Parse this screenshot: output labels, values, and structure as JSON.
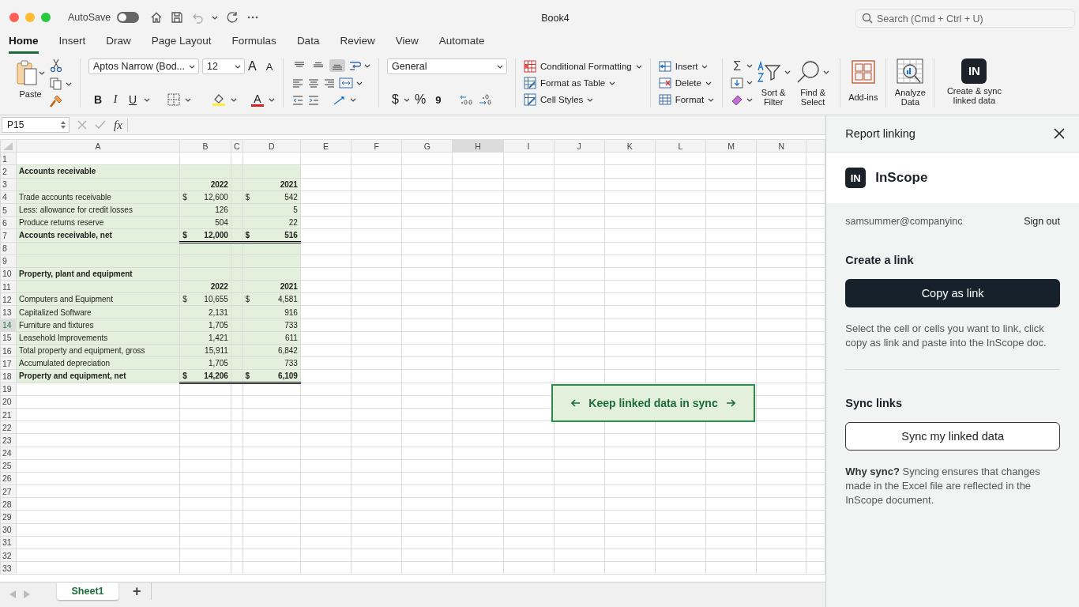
{
  "titlebar": {
    "autosave": {
      "label": "AutoSave",
      "on": false
    },
    "title": "Book4",
    "search": {
      "placeholder": "Search (Cmd + Ctrl + U)"
    }
  },
  "tabs": [
    {
      "label": "Home",
      "selected": true
    },
    {
      "label": "Insert",
      "selected": false
    },
    {
      "label": "Draw",
      "selected": false
    },
    {
      "label": "Page Layout",
      "selected": false
    },
    {
      "label": "Formulas",
      "selected": false
    },
    {
      "label": "Data",
      "selected": false
    },
    {
      "label": "Review",
      "selected": false
    },
    {
      "label": "View",
      "selected": false
    },
    {
      "label": "Automate",
      "selected": false
    }
  ],
  "ribbon": {
    "paste": "Paste",
    "font_name": "Aptos Narrow (Bod...",
    "font_size": "12",
    "grow_font": "A",
    "shrink_font": "A",
    "bold": "B",
    "italic": "I",
    "underline": "U",
    "font_color": "A",
    "vertical_align": [
      {
        "kind": "top",
        "selected": false
      },
      {
        "kind": "middle",
        "selected": false
      },
      {
        "kind": "bottom",
        "selected": true
      }
    ],
    "number_format": "General",
    "currency": "$",
    "percent": "%",
    "comma": "9",
    "styles": [
      "Conditional Formatting",
      "Format as Table",
      "Cell Styles"
    ],
    "cells": [
      "Insert",
      "Delete",
      "Format"
    ],
    "autosum": "Σ",
    "sort_filter": "Sort & Filter",
    "find_select": "Find & Select",
    "add_ins": "Add-ins",
    "analyze_data": "Analyze Data",
    "addin_logo": "IN",
    "create_sync": "Create & sync linked data"
  },
  "formula_bar": {
    "name_box": "P15",
    "fx": "fx"
  },
  "columns": [
    {
      "label": "A",
      "selected": false
    },
    {
      "label": "B",
      "selected": false
    },
    {
      "label": "C",
      "selected": false
    },
    {
      "label": "D",
      "selected": false
    },
    {
      "label": "E",
      "selected": false
    },
    {
      "label": "F",
      "selected": false
    },
    {
      "label": "G",
      "selected": false
    },
    {
      "label": "H",
      "selected": true
    },
    {
      "label": "I",
      "selected": false
    },
    {
      "label": "J",
      "selected": false
    },
    {
      "label": "K",
      "selected": false
    },
    {
      "label": "L",
      "selected": false
    },
    {
      "label": "M",
      "selected": false
    },
    {
      "label": "N",
      "selected": false
    }
  ],
  "rows": [
    {
      "number": "1",
      "selected": false,
      "filled": false,
      "total": false
    },
    {
      "number": "2",
      "selected": false,
      "filled": true,
      "bold": true,
      "total": false,
      "label": "Accounts receivable"
    },
    {
      "number": "3",
      "selected": false,
      "filled": true,
      "bold": true,
      "total": false,
      "b": "2022",
      "d": "2021"
    },
    {
      "number": "4",
      "selected": false,
      "filled": true,
      "bold": false,
      "total": false,
      "label": "Trade accounts receivable",
      "b_currency": "$",
      "b": "12,600",
      "d_currency": "$",
      "d": "542"
    },
    {
      "number": "5",
      "selected": false,
      "filled": true,
      "bold": false,
      "total": false,
      "label": "Less: allowance for credit losses",
      "b": "126",
      "d": "5"
    },
    {
      "number": "6",
      "selected": false,
      "filled": true,
      "bold": false,
      "total": false,
      "label": "Produce returns reserve",
      "b": "504",
      "d": "22"
    },
    {
      "number": "7",
      "selected": false,
      "filled": true,
      "bold": true,
      "total": true,
      "label": "Accounts receivable, net",
      "b_currency": "$",
      "b": "12,000",
      "d_currency": "$",
      "d": "516"
    },
    {
      "number": "8",
      "selected": false,
      "filled": true,
      "total": false
    },
    {
      "number": "9",
      "selected": false,
      "filled": true,
      "total": false
    },
    {
      "number": "10",
      "selected": false,
      "filled": true,
      "bold": true,
      "total": false,
      "label": "Property, plant and equipment"
    },
    {
      "number": "11",
      "selected": false,
      "filled": true,
      "bold": true,
      "total": false,
      "b": "2022",
      "d": "2021"
    },
    {
      "number": "12",
      "selected": false,
      "filled": true,
      "bold": false,
      "total": false,
      "label": "Computers and Equipment",
      "b_currency": "$",
      "b": "10,655",
      "d_currency": "$",
      "d": "4,581"
    },
    {
      "number": "13",
      "selected": false,
      "filled": true,
      "bold": false,
      "total": false,
      "label": "Capitalized Software",
      "b": "2,131",
      "d": "916"
    },
    {
      "number": "14",
      "selected": true,
      "filled": true,
      "bold": false,
      "total": false,
      "label": "Furniture and fixtures",
      "b": "1,705",
      "d": "733"
    },
    {
      "number": "15",
      "selected": false,
      "filled": true,
      "bold": false,
      "total": false,
      "label": "Leasehold Improvements",
      "b": "1,421",
      "d": "611"
    },
    {
      "number": "16",
      "selected": false,
      "filled": true,
      "bold": false,
      "total": false,
      "label": "Total property and equipment, gross",
      "b": "15,911",
      "d": "6,842"
    },
    {
      "number": "17",
      "selected": false,
      "filled": true,
      "bold": false,
      "total": false,
      "label": "Accumulated depreciation",
      "b": "1,705",
      "d": "733"
    },
    {
      "number": "18",
      "selected": false,
      "filled": true,
      "bold": true,
      "total": true,
      "label": "Property and equipment, net",
      "b_currency": "$",
      "b": "14,206",
      "d_currency": "$",
      "d": "6,109"
    },
    {
      "number": "19",
      "selected": false,
      "filled": false,
      "total": false
    },
    {
      "number": "20",
      "selected": false,
      "filled": false,
      "total": false
    },
    {
      "number": "21",
      "selected": false,
      "filled": false,
      "total": false
    },
    {
      "number": "22",
      "selected": false,
      "filled": false,
      "total": false
    },
    {
      "number": "23",
      "selected": false,
      "filled": false,
      "total": false
    },
    {
      "number": "24",
      "selected": false,
      "filled": false,
      "total": false
    },
    {
      "number": "25",
      "selected": false,
      "filled": false,
      "total": false
    },
    {
      "number": "26",
      "selected": false,
      "filled": false,
      "total": false
    },
    {
      "number": "27",
      "selected": false,
      "filled": false,
      "total": false
    },
    {
      "number": "28",
      "selected": false,
      "filled": false,
      "total": false
    },
    {
      "number": "29",
      "selected": false,
      "filled": false,
      "total": false
    },
    {
      "number": "30",
      "selected": false,
      "filled": false,
      "total": false
    },
    {
      "number": "31",
      "selected": false,
      "filled": false,
      "total": false
    },
    {
      "number": "32",
      "selected": false,
      "filled": false,
      "total": false
    },
    {
      "number": "33",
      "selected": false,
      "filled": false,
      "total": false
    }
  ],
  "callout": {
    "text": "Keep linked data in sync"
  },
  "sheet_tabs": [
    {
      "label": "Sheet1",
      "selected": true
    }
  ],
  "add_sheet": "+",
  "sidebar": {
    "title": "Report linking",
    "logo": "IN",
    "brand": "InScope",
    "email": "samsummer@companyinc",
    "sign_out": "Sign out",
    "create_heading": "Create a link",
    "copy_button": "Copy as link",
    "create_text": "Select the cell or cells you want to link, click copy as link and paste into the InScope doc.",
    "sync_heading": "Sync links",
    "sync_button": "Sync my linked data",
    "sync_text": "**Why sync?** Syncing ensures that changes made in the Excel file are reflected in the InScope document."
  }
}
